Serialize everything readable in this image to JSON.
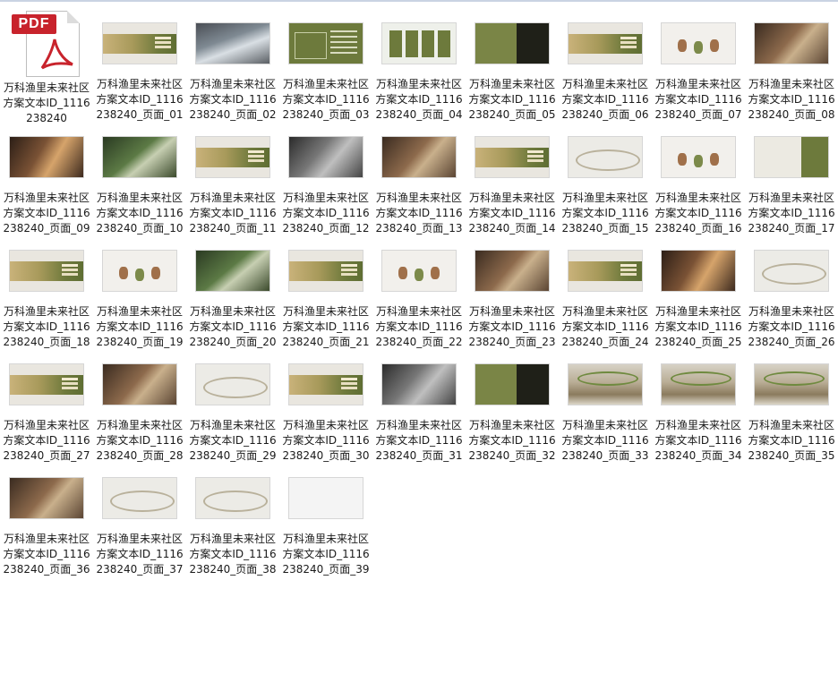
{
  "pdf_badge": "PDF",
  "files": [
    {
      "name": "万科渔里未来社区方案文本ID_1116238240",
      "kind": "pdf"
    },
    {
      "name": "万科渔里未来社区方案文本ID_1116238240_页面_01",
      "kind": "band"
    },
    {
      "name": "万科渔里未来社区方案文本ID_1116238240_页面_02",
      "kind": "photo-dark"
    },
    {
      "name": "万科渔里未来社区方案文本ID_1116238240_页面_03",
      "kind": "green"
    },
    {
      "name": "万科渔里未来社区方案文本ID_1116238240_页面_04",
      "kind": "cards"
    },
    {
      "name": "万科渔里未来社区方案文本ID_1116238240_页面_05",
      "kind": "split"
    },
    {
      "name": "万科渔里未来社区方案文本ID_1116238240_页面_06",
      "kind": "band"
    },
    {
      "name": "万科渔里未来社区方案文本ID_1116238240_页面_07",
      "kind": "light"
    },
    {
      "name": "万科渔里未来社区方案文本ID_1116238240_页面_08",
      "kind": "photo-interior"
    },
    {
      "name": "万科渔里未来社区方案文本ID_1116238240_页面_09",
      "kind": "photo-warm"
    },
    {
      "name": "万科渔里未来社区方案文本ID_1116238240_页面_10",
      "kind": "photo-forest"
    },
    {
      "name": "万科渔里未来社区方案文本ID_1116238240_页面_11",
      "kind": "band"
    },
    {
      "name": "万科渔里未来社区方案文本ID_1116238240_页面_12",
      "kind": "photo-bw"
    },
    {
      "name": "万科渔里未来社区方案文本ID_1116238240_页面_13",
      "kind": "photo-interior"
    },
    {
      "name": "万科渔里未来社区方案文本ID_1116238240_页面_14",
      "kind": "band"
    },
    {
      "name": "万科渔里未来社区方案文本ID_1116238240_页面_15",
      "kind": "wave"
    },
    {
      "name": "万科渔里未来社区方案文本ID_1116238240_页面_16",
      "kind": "light"
    },
    {
      "name": "万科渔里未来社区方案文本ID_1116238240_页面_17",
      "kind": "lightgreen"
    },
    {
      "name": "万科渔里未来社区方案文本ID_1116238240_页面_18",
      "kind": "band"
    },
    {
      "name": "万科渔里未来社区方案文本ID_1116238240_页面_19",
      "kind": "light"
    },
    {
      "name": "万科渔里未来社区方案文本ID_1116238240_页面_20",
      "kind": "photo-forest"
    },
    {
      "name": "万科渔里未来社区方案文本ID_1116238240_页面_21",
      "kind": "band"
    },
    {
      "name": "万科渔里未来社区方案文本ID_1116238240_页面_22",
      "kind": "light"
    },
    {
      "name": "万科渔里未来社区方案文本ID_1116238240_页面_23",
      "kind": "photo-interior"
    },
    {
      "name": "万科渔里未来社区方案文本ID_1116238240_页面_24",
      "kind": "band"
    },
    {
      "name": "万科渔里未来社区方案文本ID_1116238240_页面_25",
      "kind": "photo-warm"
    },
    {
      "name": "万科渔里未来社区方案文本ID_1116238240_页面_26",
      "kind": "wave"
    },
    {
      "name": "万科渔里未来社区方案文本ID_1116238240_页面_27",
      "kind": "band"
    },
    {
      "name": "万科渔里未来社区方案文本ID_1116238240_页面_28",
      "kind": "photo-interior"
    },
    {
      "name": "万科渔里未来社区方案文本ID_1116238240_页面_29",
      "kind": "wave"
    },
    {
      "name": "万科渔里未来社区方案文本ID_1116238240_页面_30",
      "kind": "band"
    },
    {
      "name": "万科渔里未来社区方案文本ID_1116238240_页面_31",
      "kind": "photo-bw"
    },
    {
      "name": "万科渔里未来社区方案文本ID_1116238240_页面_32",
      "kind": "split"
    },
    {
      "name": "万科渔里未来社区方案文本ID_1116238240_页面_33",
      "kind": "photo-atrium"
    },
    {
      "name": "万科渔里未来社区方案文本ID_1116238240_页面_34",
      "kind": "photo-atrium"
    },
    {
      "name": "万科渔里未来社区方案文本ID_1116238240_页面_35",
      "kind": "photo-atrium"
    },
    {
      "name": "万科渔里未来社区方案文本ID_1116238240_页面_36",
      "kind": "photo-interior"
    },
    {
      "name": "万科渔里未来社区方案文本ID_1116238240_页面_37",
      "kind": "wave"
    },
    {
      "name": "万科渔里未来社区方案文本ID_1116238240_页面_38",
      "kind": "wave"
    },
    {
      "name": "万科渔里未来社区方案文本ID_1116238240_页面_39",
      "kind": "empty"
    }
  ]
}
